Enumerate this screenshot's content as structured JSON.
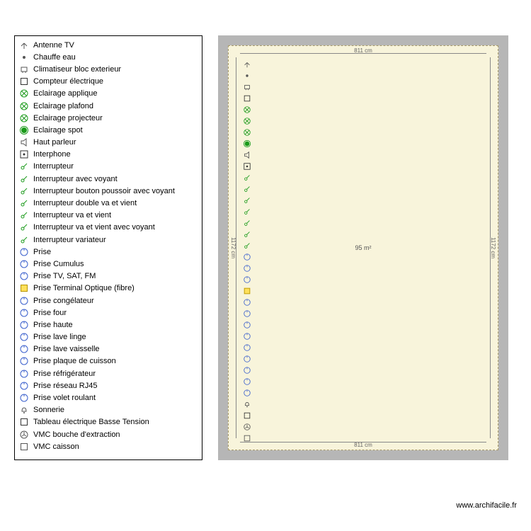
{
  "legend": {
    "items": [
      {
        "iconColor": "#555",
        "shape": "antenna",
        "label": "Antenne TV"
      },
      {
        "iconColor": "#888",
        "shape": "dot",
        "label": "Chauffe eau"
      },
      {
        "iconColor": "#555",
        "shape": "clim",
        "label": "Climatiseur bloc exterieur"
      },
      {
        "iconColor": "#333",
        "shape": "square",
        "label": "Compteur électrique"
      },
      {
        "iconColor": "#1a9a1a",
        "shape": "circle-x",
        "label": "Eclairage applique"
      },
      {
        "iconColor": "#1a9a1a",
        "shape": "circle-x",
        "label": "Eclairage plafond"
      },
      {
        "iconColor": "#1a9a1a",
        "shape": "circle-x",
        "label": "Eclairage projecteur"
      },
      {
        "iconColor": "#1a9a1a",
        "shape": "spot",
        "label": "Eclairage spot"
      },
      {
        "iconColor": "#555",
        "shape": "speaker",
        "label": "Haut parleur"
      },
      {
        "iconColor": "#333",
        "shape": "square-dot",
        "label": "Interphone"
      },
      {
        "iconColor": "#1a9a1a",
        "shape": "switch",
        "label": "Interrupteur"
      },
      {
        "iconColor": "#1a9a1a",
        "shape": "switch-v",
        "label": "Interrupteur avec voyant"
      },
      {
        "iconColor": "#1a9a1a",
        "shape": "switch-bp",
        "label": "Interrupteur bouton poussoir avec voyant"
      },
      {
        "iconColor": "#1a9a1a",
        "shape": "switch-dv",
        "label": "Interrupteur double va et vient"
      },
      {
        "iconColor": "#1a9a1a",
        "shape": "switch-va",
        "label": "Interrupteur va et vient"
      },
      {
        "iconColor": "#1a9a1a",
        "shape": "switch-vav",
        "label": "Interrupteur va et vient avec voyant"
      },
      {
        "iconColor": "#1a9a1a",
        "shape": "switch-var",
        "label": "Interrupteur variateur"
      },
      {
        "iconColor": "#3a5fcc",
        "shape": "prise",
        "label": "Prise"
      },
      {
        "iconColor": "#3a5fcc",
        "shape": "prise",
        "label": "Prise Cumulus"
      },
      {
        "iconColor": "#3a5fcc",
        "shape": "prise",
        "label": "Prise TV, SAT, FM"
      },
      {
        "iconColor": "#b59400",
        "shape": "square-y",
        "label": "Prise Terminal Optique (fibre)"
      },
      {
        "iconColor": "#3a5fcc",
        "shape": "prise",
        "label": "Prise congélateur"
      },
      {
        "iconColor": "#3a5fcc",
        "shape": "prise",
        "label": "Prise four"
      },
      {
        "iconColor": "#3a5fcc",
        "shape": "prise",
        "label": "Prise haute"
      },
      {
        "iconColor": "#3a5fcc",
        "shape": "prise",
        "label": "Prise lave linge"
      },
      {
        "iconColor": "#3a5fcc",
        "shape": "prise",
        "label": "Prise lave vaisselle"
      },
      {
        "iconColor": "#3a5fcc",
        "shape": "prise",
        "label": "Prise plaque de cuisson"
      },
      {
        "iconColor": "#3a5fcc",
        "shape": "prise",
        "label": "Prise réfrigérateur"
      },
      {
        "iconColor": "#3a5fcc",
        "shape": "prise",
        "label": "Prise réseau RJ45"
      },
      {
        "iconColor": "#3a5fcc",
        "shape": "prise",
        "label": "Prise volet roulant"
      },
      {
        "iconColor": "#555",
        "shape": "bell",
        "label": "Sonnerie"
      },
      {
        "iconColor": "#333",
        "shape": "square",
        "label": "Tableau électrique Basse Tension"
      },
      {
        "iconColor": "#555",
        "shape": "fan",
        "label": "VMC bouche d'extraction"
      },
      {
        "iconColor": "#555",
        "shape": "square",
        "label": "VMC caisson"
      }
    ]
  },
  "plan": {
    "width_cm": "811 cm",
    "height_cm": "1172 cm",
    "area": "95 m²"
  },
  "footer": {
    "url": "www.archifacile.fr"
  }
}
